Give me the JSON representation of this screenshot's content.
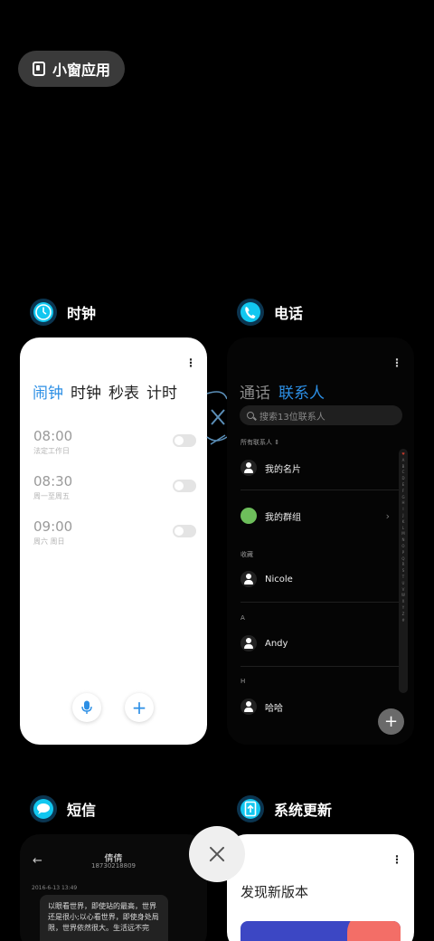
{
  "freeform": {
    "label": "小窗应用"
  },
  "apps": [
    {
      "name": "时钟"
    },
    {
      "name": "电话"
    },
    {
      "name": "短信"
    },
    {
      "name": "系统更新"
    }
  ],
  "clock": {
    "tabs": [
      "闹钟",
      "时钟",
      "秒表",
      "计时"
    ],
    "active_tab": "闹钟",
    "alarms": [
      {
        "time": "08:00",
        "repeat": "法定工作日",
        "enabled": false
      },
      {
        "time": "08:30",
        "repeat": "周一至周五",
        "enabled": false
      },
      {
        "time": "09:00",
        "repeat": "周六 周日",
        "enabled": false
      }
    ],
    "accent": "#2c8fe5"
  },
  "phone": {
    "tabs": [
      "通话",
      "联系人"
    ],
    "active_tab": "联系人",
    "search_placeholder": "搜索13位联系人",
    "all_contacts": "所有联系人",
    "my_card": "我的名片",
    "my_groups": "我的群组",
    "section_fav": "收藏",
    "section_a": "A",
    "section_h": "H",
    "contacts": [
      "Nicole",
      "Andy",
      "哈哈"
    ],
    "index_letters": [
      "♥",
      "A",
      "B",
      "C",
      "D",
      "E",
      "F",
      "G",
      "H",
      "I",
      "J",
      "K",
      "L",
      "M",
      "N",
      "O",
      "P",
      "Q",
      "R",
      "S",
      "T",
      "U",
      "V",
      "W",
      "X",
      "Y",
      "Z",
      "#"
    ]
  },
  "messages": {
    "contact_name": "倩倩",
    "contact_number": "18730218809",
    "date": "2016-6-13 13:49",
    "bubble_text": "以眼看世界，即使站的最高，世界还是很小;以心看世界，即使身处局限，世界依然很大。生活远不完"
  },
  "update": {
    "title": "发现新版本"
  },
  "colors": {
    "background": "#000000",
    "accent": "#2c8fe5"
  }
}
